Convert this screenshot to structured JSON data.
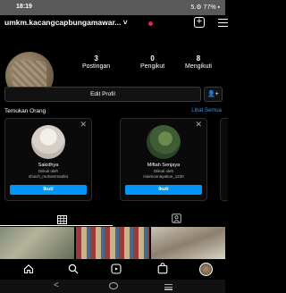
{
  "status_bar": {
    "time": "18:19",
    "right": "5.⚙ 77% ▪"
  },
  "header": {
    "username": "umkm.kacangcapbungamawar... ˅"
  },
  "stats": [
    {
      "value": "3",
      "label": "Postingan"
    },
    {
      "value": "0",
      "label": "Pengikut"
    },
    {
      "value": "8",
      "label": "Mengikuti"
    }
  ],
  "edit_profile_label": "Edit Profil",
  "discover": {
    "title": "Temukan Orang",
    "see_all": "Lihat Semua"
  },
  "suggestions": [
    {
      "name": "Sakidhya",
      "sub_line": "Diikuti oleh",
      "followed_by": "shoich_muhammad54",
      "follow_label": "Ikuti"
    },
    {
      "name": "Miftah Senjaya",
      "sub_line": "Diikuti oleh",
      "followed_by": "maimoonayakoe_1230",
      "follow_label": "Ikuti"
    }
  ],
  "colors": {
    "follow_button": "#0095f6",
    "link": "#3897f0",
    "notification_dot": "#e0245e"
  },
  "icons": {
    "grid_tab": "grid-icon",
    "tagged_tab": "tagged-icon",
    "nav": [
      "home-icon",
      "search-icon",
      "reels-icon",
      "shop-icon",
      "profile-avatar"
    ]
  }
}
